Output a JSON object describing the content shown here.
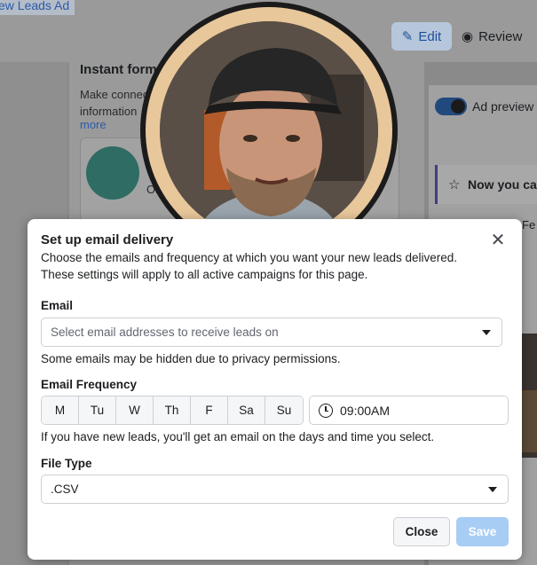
{
  "background": {
    "ad_title": "ew Leads Ad",
    "edit_label": "Edit",
    "review_label": "Review",
    "instant_form_title": "Instant form",
    "instant_form_desc": "Make connec information",
    "more_link": "more",
    "card_text": "Ol cust",
    "ad_preview_label": "Ad preview",
    "notification_text": "Now you ca",
    "partial_text": "Fe"
  },
  "modal": {
    "title": "Set up email delivery",
    "description_line1": "Choose the emails and frequency at which you want your new leads delivered.",
    "description_line2": "These settings will apply to all active campaigns for this page.",
    "email_label": "Email",
    "email_placeholder": "Select email addresses to receive leads on",
    "email_note": "Some emails may be hidden due to privacy permissions.",
    "frequency_label": "Email Frequency",
    "days": [
      "M",
      "Tu",
      "W",
      "Th",
      "F",
      "Sa",
      "Su"
    ],
    "time": "09:00AM",
    "frequency_note": "If you have new leads, you'll get an email on the days and time you select.",
    "file_type_label": "File Type",
    "file_type_value": ".CSV",
    "close_button": "Close",
    "save_button": "Save"
  },
  "colors": {
    "primary_button_disabled": "#a8cdf5",
    "link": "#2d5aa8",
    "avatar_ring": "#e8c79b"
  },
  "icons": {
    "close": "close-icon",
    "clock": "clock-icon",
    "caret": "caret-down-icon",
    "edit": "pencil-icon",
    "review": "eye-icon",
    "star": "star-icon"
  }
}
